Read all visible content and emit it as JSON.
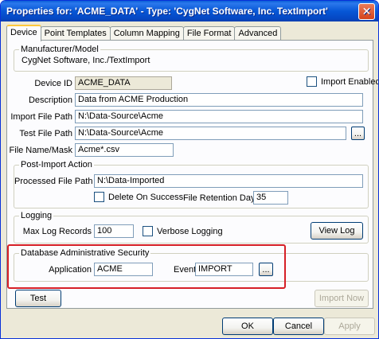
{
  "window": {
    "title": "Properties for: 'ACME_DATA' - Type: 'CygNet Software, Inc. TextImport'",
    "close_glyph": "✕"
  },
  "tabs": [
    {
      "label": "Device",
      "active": true
    },
    {
      "label": "Point Templates"
    },
    {
      "label": "Column Mapping"
    },
    {
      "label": "File Format"
    },
    {
      "label": "Advanced"
    }
  ],
  "manufacturer": {
    "group_title": "Manufacturer/Model",
    "value": "CygNet Software, Inc./TextImport"
  },
  "device": {
    "device_id_label": "Device ID",
    "device_id": "ACME_DATA",
    "import_enabled_label": "Import Enabled",
    "description_label": "Description",
    "description": "Data from ACME Production",
    "import_file_path_label": "Import File Path",
    "import_file_path": "N:\\Data-Source\\Acme",
    "test_file_path_label": "Test File Path",
    "test_file_path": "N:\\Data-Source\\Acme",
    "browse_label": "...",
    "file_name_mask_label": "File Name/Mask",
    "file_name_mask": "Acme*.csv"
  },
  "post_import": {
    "group_title": "Post-Import Action",
    "processed_file_path_label": "Processed File Path",
    "processed_file_path": "N:\\Data-Imported",
    "delete_on_success_label": "Delete On Success",
    "file_retention_days_label": "File Retention Days",
    "file_retention_days": "35"
  },
  "logging": {
    "group_title": "Logging",
    "max_log_records_label": "Max Log Records",
    "max_log_records": "100",
    "verbose_logging_label": "Verbose Logging",
    "view_log_label": "View Log"
  },
  "security": {
    "group_title": "Database Administrative Security",
    "application_label": "Application",
    "application": "ACME",
    "event_label": "Event",
    "event": "IMPORT",
    "browse_label": "...",
    "highlight_color": "#d61f26"
  },
  "buttons": {
    "test": "Test",
    "import_now": "Import Now",
    "ok": "OK",
    "cancel": "Cancel",
    "apply": "Apply"
  }
}
